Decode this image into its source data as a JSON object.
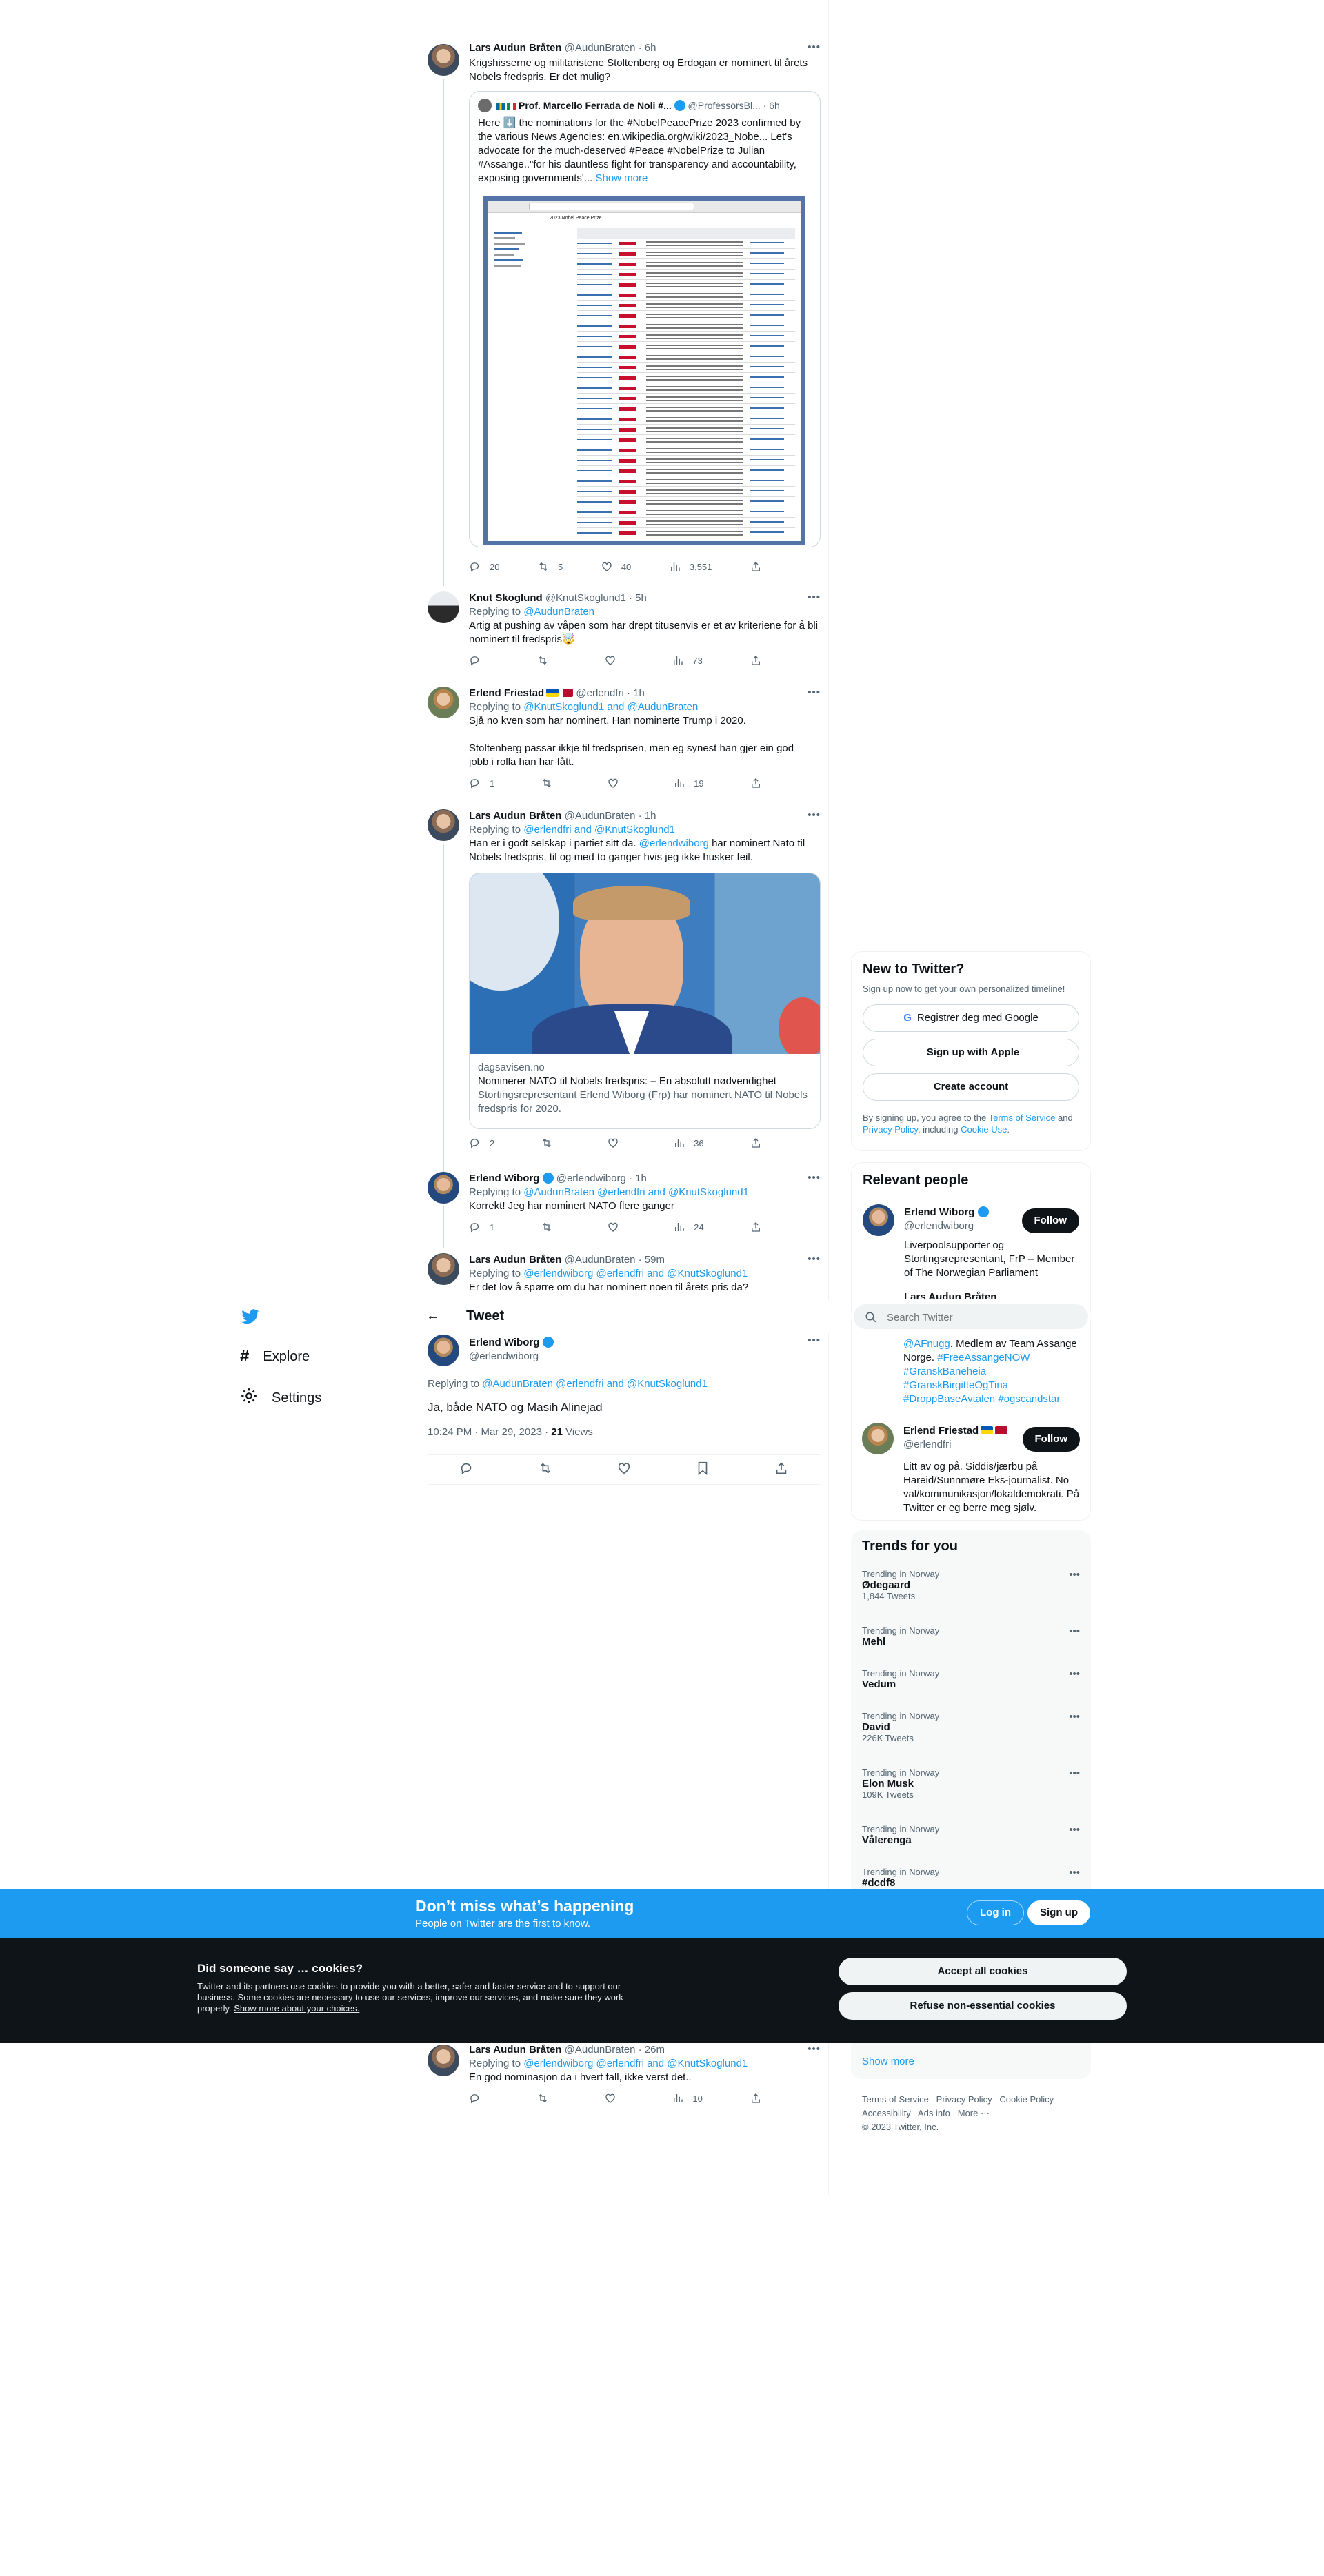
{
  "nav": {
    "explore": "Explore",
    "settings": "Settings"
  },
  "colors": {
    "accent": "#1d9bf0",
    "text": "#0f1419",
    "muted": "#536471",
    "banner": "#1d9bf0",
    "cookie_bg": "#0f1419",
    "verified": "#1d9bf0"
  },
  "tweets": {
    "t1": {
      "name": "Lars Audun Bråten",
      "meta": "@AudunBraten · 6h",
      "text": "Krigshisserne og militaristene Stoltenberg og Erdogan er nominert til årets Nobels fredspris. Er det mulig?",
      "quote": {
        "name": "Prof. Marcello Ferrada de Noli #...",
        "handle": "@ProfessorsBl...",
        "time": "· 6h",
        "text": "Here ⬇️ the nominations for the #NobelPeacePrize 2023 confirmed by the various News Agencies: en.wikipedia.org/wiki/2023_Nobe... Let's advocate for the much-deserved #Peace #NobelPrize to Julian #Assange..\"for his dauntless fight for transparency and accountability, exposing governments'...",
        "show_more": "Show more",
        "img_title": "2023 Nobel Peace Prize",
        "img_nominees": "Nominee"
      },
      "replies": "20",
      "retweets": "5",
      "likes": "40",
      "views": "3,551"
    },
    "t2": {
      "name": "Knut Skoglund",
      "meta": "@KnutSkoglund1 · 5h",
      "replying_prefix": "Replying to",
      "replying": "@AudunBraten",
      "text": "Artig at pushing av våpen som har drept titusenvis er et av kriteriene for å bli nominert til fredspris🤯",
      "replies": "",
      "retweets": "",
      "likes": "",
      "views": "73"
    },
    "t3": {
      "name": "Erlend Friestad",
      "meta": "@erlendfri · 1h",
      "replying_prefix": "Replying to",
      "replying": "@KnutSkoglund1 and @AudunBraten",
      "text1": "Sjå no kven som har nominert. Han nominerte Trump i 2020.",
      "text2": "Stoltenberg passar ikkje til fredsprisen, men eg synest han gjer ein god jobb i rolla han har fått.",
      "replies": "1",
      "retweets": "",
      "likes": "",
      "views": "19"
    },
    "t4": {
      "name": "Lars Audun Bråten",
      "meta": "@AudunBraten · 1h",
      "replying_prefix": "Replying to",
      "replying": "@erlendfri and @KnutSkoglund1",
      "text_a": "Han er i godt selskap i partiet sitt da. ",
      "mention": "@erlendwiborg",
      "text_b": " har nominert Nato til Nobels fredspris, til og med to ganger hvis jeg ikke husker feil.",
      "card_domain": "dagsavisen.no",
      "card_title": "Nominerer NATO til Nobels fredspris: – En absolutt nødvendighet",
      "card_desc": "Stortingsrepresentant Erlend Wiborg (Frp) har nominert NATO til Nobels fredspris for 2020.",
      "replies": "2",
      "retweets": "",
      "likes": "",
      "views": "36"
    },
    "t5": {
      "name": "Erlend Wiborg",
      "meta": "@erlendwiborg · 1h",
      "replying_prefix": "Replying to",
      "replying": "@AudunBraten @erlendfri and @KnutSkoglund1",
      "text": "Korrekt! Jeg har nominert NATO flere ganger",
      "replies": "1",
      "retweets": "",
      "likes": "",
      "views": "24"
    },
    "t6": {
      "name": "Lars Audun Bråten",
      "meta": "@AudunBraten · 59m",
      "replying_prefix": "Replying to",
      "replying": "@erlendwiborg @erlendfri and @KnutSkoglund1",
      "text": "Er det lov å spørre om du har nominert noen til årets pris da?"
    },
    "t8": {
      "name": "Lars Audun Bråten",
      "meta": "@AudunBraten · 26m",
      "replying_prefix": "Replying to",
      "replying": "@erlendwiborg @erlendfri and @KnutSkoglund1",
      "text": "En god nominasjon da i hvert fall, ikke verst det..",
      "replies": "",
      "retweets": "",
      "likes": "",
      "views": "10"
    }
  },
  "focused": {
    "header": "Tweet",
    "name": "Erlend Wiborg",
    "handle": "@erlendwiborg",
    "replying_prefix": "Replying to",
    "replying": "@AudunBraten @erlendfri and @KnutSkoglund1",
    "text": "Ja, både NATO og Masih Alinejad",
    "time": "10:24 PM · Mar 29, 2023 · ",
    "views_num": "21",
    "views_label": "Views"
  },
  "signup": {
    "title": "New to Twitter?",
    "sub": "Sign up now to get your own personalized timeline!",
    "google": "Registrer deg med Google",
    "apple": "Sign up with Apple",
    "create": "Create account",
    "terms_a": "By signing up, you agree to the ",
    "terms_link": "Terms of Service",
    "terms_b": " and ",
    "privacy_link": "Privacy Policy",
    "terms_c": ", including ",
    "cookie_link": "Cookie Use",
    "terms_d": "."
  },
  "relevant": {
    "title": "Relevant people",
    "follow": "Follow",
    "p1": {
      "name": "Erlend Wiborg",
      "handle": "@erlendwiborg",
      "bio": "Liverpoolsupporter og Stortingsrepresentant, FrP – Member of The Norwegian Parliament"
    },
    "p2": {
      "name": "Lars Audun Bråten"
    },
    "p2bio": {
      "a": "@AFnugg",
      "b": ". Medlem av Team Assange Norge. ",
      "c": "#FreeAssangeNOW",
      "d": "#GranskBaneheia",
      "e": "#GranskBirgitteOgTina",
      "f": "#DroppBaseAvtalen",
      "g": "#ogscandstar"
    },
    "p3": {
      "name": "Erlend Friestad",
      "handle": "@erlendfri",
      "bio": "Litt av og på. Siddis/jærbu på Hareid/Sunnmøre Eks-journalist. No val/kommunikasjon/lokaldemokrati. På Twitter er eg berre meg sjølv."
    }
  },
  "search": {
    "placeholder": "Search Twitter"
  },
  "trends": {
    "title": "Trends for you",
    "items": [
      {
        "ctx": "Trending in Norway",
        "name": "Ødegaard",
        "count": "1,844 Tweets"
      },
      {
        "ctx": "Trending in Norway",
        "name": "Mehl",
        "count": ""
      },
      {
        "ctx": "Trending in Norway",
        "name": "Vedum",
        "count": ""
      },
      {
        "ctx": "Trending in Norway",
        "name": "David",
        "count": "226K Tweets"
      },
      {
        "ctx": "Trending in Norway",
        "name": "Elon Musk",
        "count": "109K Tweets"
      },
      {
        "ctx": "Trending in Norway",
        "name": "Vålerenga",
        "count": ""
      },
      {
        "ctx": "Trending in Norway",
        "name": "#dcdf8",
        "count": ""
      }
    ],
    "show_more": "Show more"
  },
  "footer": {
    "terms": "Terms of Service",
    "privacy": "Privacy Policy",
    "cookie": "Cookie Policy",
    "access": "Accessibility",
    "ads": "Ads info",
    "more": "More ···",
    "copy": "© 2023 Twitter, Inc."
  },
  "banner": {
    "title": "Don’t miss what’s happening",
    "sub": "People on Twitter are the first to know.",
    "login": "Log in",
    "signup": "Sign up"
  },
  "cookies": {
    "title": "Did someone say … cookies?",
    "body": "Twitter and its partners use cookies to provide you with a better, safer and faster service and to support our business. Some cookies are necessary to use our services, improve our services, and make sure they work properly. ",
    "link": "Show more about your choices.",
    "accept": "Accept all cookies",
    "refuse": "Refuse non-essential cookies"
  }
}
